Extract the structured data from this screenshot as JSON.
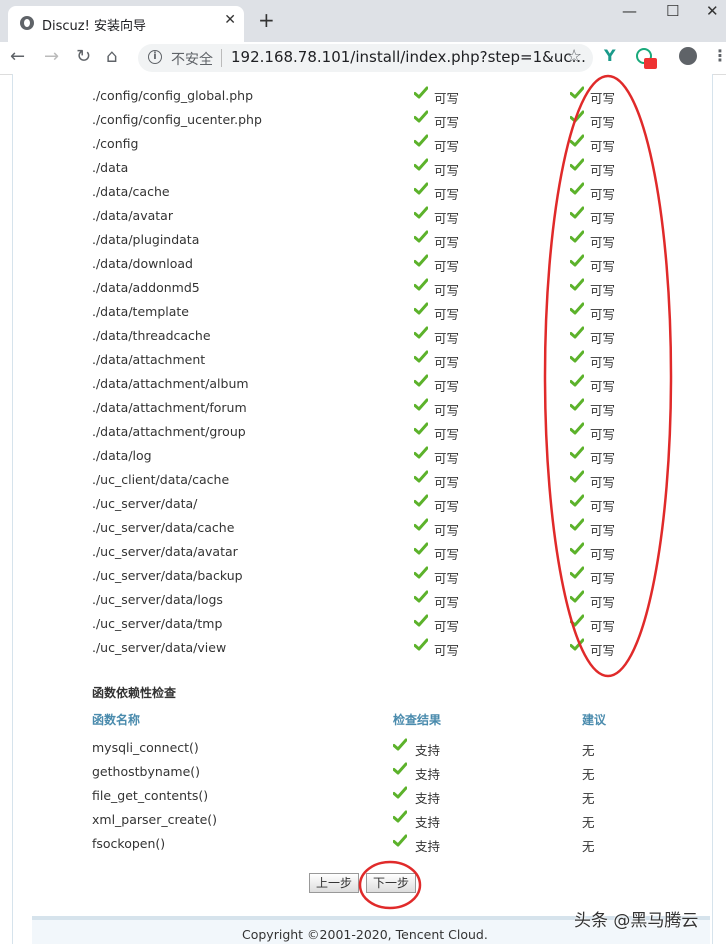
{
  "browser": {
    "tab_title": "Discuz! 安装向导",
    "security_label": "不安全",
    "url": "192.168.78.101/install/index.php?step=1&uc..."
  },
  "permission_rows": [
    {
      "path": "./config/config_global.php",
      "required": "可写",
      "current": "可写"
    },
    {
      "path": "./config/config_ucenter.php",
      "required": "可写",
      "current": "可写"
    },
    {
      "path": "./config",
      "required": "可写",
      "current": "可写"
    },
    {
      "path": "./data",
      "required": "可写",
      "current": "可写"
    },
    {
      "path": "./data/cache",
      "required": "可写",
      "current": "可写"
    },
    {
      "path": "./data/avatar",
      "required": "可写",
      "current": "可写"
    },
    {
      "path": "./data/plugindata",
      "required": "可写",
      "current": "可写"
    },
    {
      "path": "./data/download",
      "required": "可写",
      "current": "可写"
    },
    {
      "path": "./data/addonmd5",
      "required": "可写",
      "current": "可写"
    },
    {
      "path": "./data/template",
      "required": "可写",
      "current": "可写"
    },
    {
      "path": "./data/threadcache",
      "required": "可写",
      "current": "可写"
    },
    {
      "path": "./data/attachment",
      "required": "可写",
      "current": "可写"
    },
    {
      "path": "./data/attachment/album",
      "required": "可写",
      "current": "可写"
    },
    {
      "path": "./data/attachment/forum",
      "required": "可写",
      "current": "可写"
    },
    {
      "path": "./data/attachment/group",
      "required": "可写",
      "current": "可写"
    },
    {
      "path": "./data/log",
      "required": "可写",
      "current": "可写"
    },
    {
      "path": "./uc_client/data/cache",
      "required": "可写",
      "current": "可写"
    },
    {
      "path": "./uc_server/data/",
      "required": "可写",
      "current": "可写"
    },
    {
      "path": "./uc_server/data/cache",
      "required": "可写",
      "current": "可写"
    },
    {
      "path": "./uc_server/data/avatar",
      "required": "可写",
      "current": "可写"
    },
    {
      "path": "./uc_server/data/backup",
      "required": "可写",
      "current": "可写"
    },
    {
      "path": "./uc_server/data/logs",
      "required": "可写",
      "current": "可写"
    },
    {
      "path": "./uc_server/data/tmp",
      "required": "可写",
      "current": "可写"
    },
    {
      "path": "./uc_server/data/view",
      "required": "可写",
      "current": "可写"
    }
  ],
  "func_section": {
    "title": "函数依赖性检查",
    "headers": {
      "name": "函数名称",
      "result": "检查结果",
      "advice": "建议"
    },
    "rows": [
      {
        "name": "mysqli_connect()",
        "result": "支持",
        "advice": "无"
      },
      {
        "name": "gethostbyname()",
        "result": "支持",
        "advice": "无"
      },
      {
        "name": "file_get_contents()",
        "result": "支持",
        "advice": "无"
      },
      {
        "name": "xml_parser_create()",
        "result": "支持",
        "advice": "无"
      },
      {
        "name": "fsockopen()",
        "result": "支持",
        "advice": "无"
      }
    ]
  },
  "buttons": {
    "prev": "上一步",
    "next": "下一步"
  },
  "footer": {
    "copyright": "Copyright ©2001-2020, Tencent Cloud."
  },
  "watermark": "头条 @黑马腾云",
  "colors": {
    "check_green": "#5cb22b",
    "header_blue": "#4a8bad",
    "annotation_red": "#e02a2a"
  }
}
